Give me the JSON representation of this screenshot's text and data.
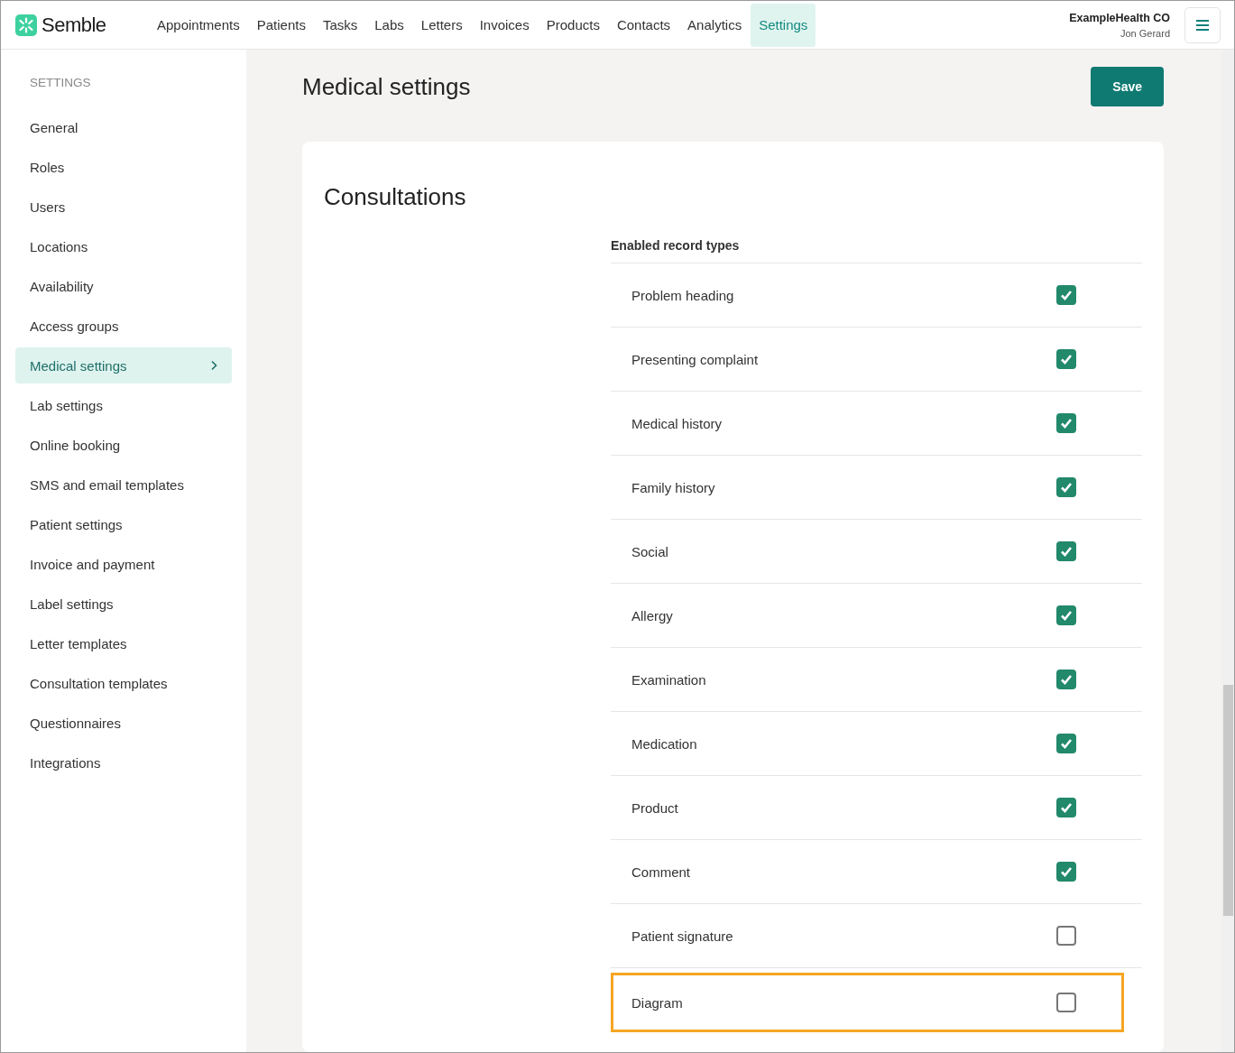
{
  "header": {
    "brand": "Semble",
    "nav": [
      {
        "label": "Appointments",
        "selected": false
      },
      {
        "label": "Patients",
        "selected": false
      },
      {
        "label": "Tasks",
        "selected": false
      },
      {
        "label": "Labs",
        "selected": false
      },
      {
        "label": "Letters",
        "selected": false
      },
      {
        "label": "Invoices",
        "selected": false
      },
      {
        "label": "Products",
        "selected": false
      },
      {
        "label": "Contacts",
        "selected": false
      },
      {
        "label": "Analytics",
        "selected": false
      },
      {
        "label": "Settings",
        "selected": true
      }
    ],
    "organisation": "ExampleHealth CO",
    "user": "Jon Gerard"
  },
  "sidebar": {
    "heading": "SETTINGS",
    "items": [
      {
        "label": "General",
        "selected": false
      },
      {
        "label": "Roles",
        "selected": false
      },
      {
        "label": "Users",
        "selected": false
      },
      {
        "label": "Locations",
        "selected": false
      },
      {
        "label": "Availability",
        "selected": false
      },
      {
        "label": "Access groups",
        "selected": false
      },
      {
        "label": "Medical settings",
        "selected": true
      },
      {
        "label": "Lab settings",
        "selected": false
      },
      {
        "label": "Online booking",
        "selected": false
      },
      {
        "label": "SMS and email templates",
        "selected": false
      },
      {
        "label": "Patient settings",
        "selected": false
      },
      {
        "label": "Invoice and payment",
        "selected": false
      },
      {
        "label": "Label settings",
        "selected": false
      },
      {
        "label": "Letter templates",
        "selected": false
      },
      {
        "label": "Consultation templates",
        "selected": false
      },
      {
        "label": "Questionnaires",
        "selected": false
      },
      {
        "label": "Integrations",
        "selected": false
      }
    ]
  },
  "page": {
    "title": "Medical settings",
    "save_button": "Save"
  },
  "section": {
    "title": "Consultations",
    "list_label": "Enabled record types",
    "record_types": [
      {
        "label": "Problem heading",
        "checked": true,
        "highlighted": false
      },
      {
        "label": "Presenting complaint",
        "checked": true,
        "highlighted": false
      },
      {
        "label": "Medical history",
        "checked": true,
        "highlighted": false
      },
      {
        "label": "Family history",
        "checked": true,
        "highlighted": false
      },
      {
        "label": "Social",
        "checked": true,
        "highlighted": false
      },
      {
        "label": "Allergy",
        "checked": true,
        "highlighted": false
      },
      {
        "label": "Examination",
        "checked": true,
        "highlighted": false
      },
      {
        "label": "Medication",
        "checked": true,
        "highlighted": false
      },
      {
        "label": "Product",
        "checked": true,
        "highlighted": false
      },
      {
        "label": "Comment",
        "checked": true,
        "highlighted": false
      },
      {
        "label": "Patient signature",
        "checked": false,
        "highlighted": false
      },
      {
        "label": "Diagram",
        "checked": false,
        "highlighted": true
      }
    ]
  }
}
